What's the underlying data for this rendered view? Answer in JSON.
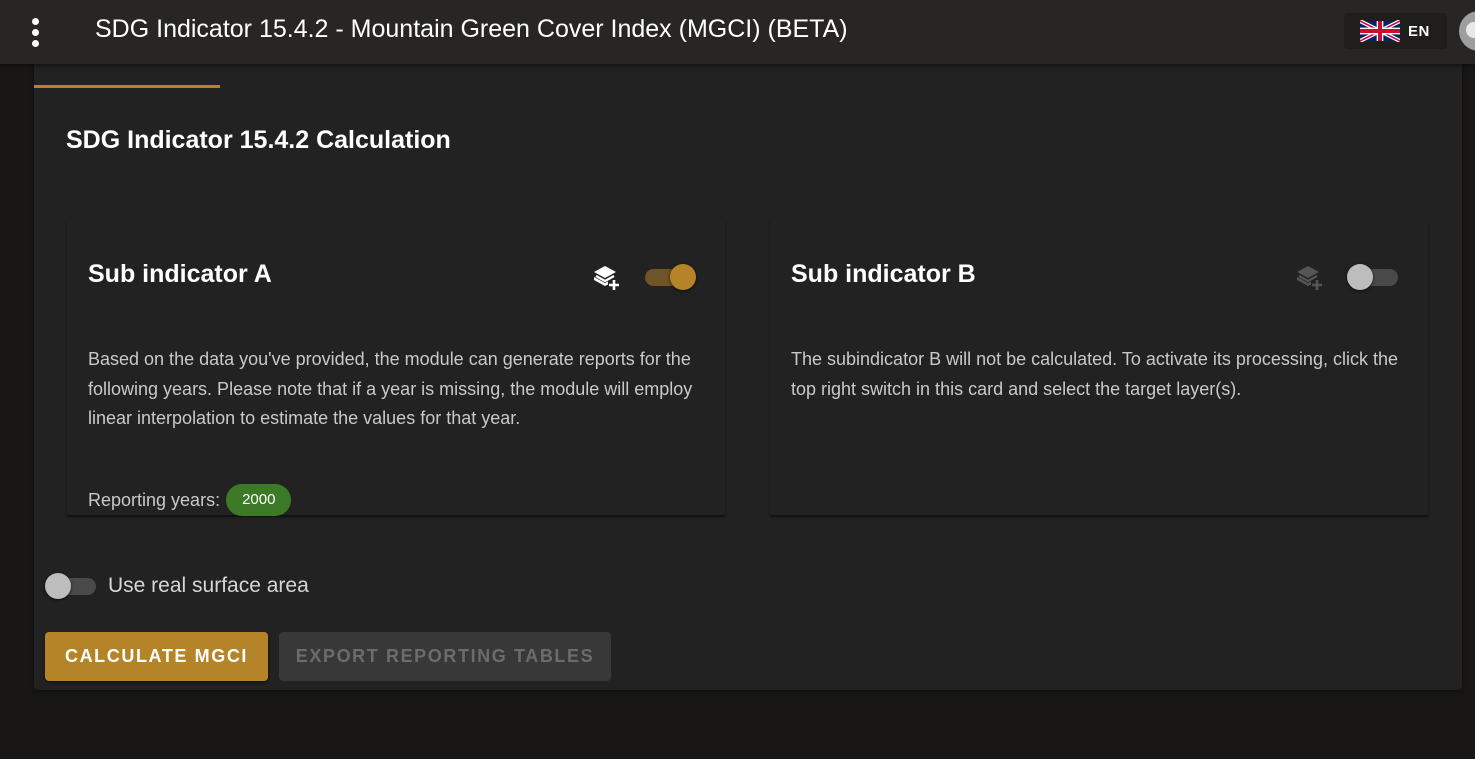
{
  "appbar": {
    "title": "SDG Indicator 15.4.2 - Mountain Green Cover Index (MGCI) (BETA)",
    "menu_icon": "more-vert-icon",
    "language": {
      "code": "EN",
      "flag_icon": "uk-flag-icon"
    },
    "avatar_icon": "avatar-icon"
  },
  "main": {
    "section_title": "SDG Indicator 15.4.2 Calculation",
    "subindicators": [
      {
        "title": "Sub indicator A",
        "enabled": true,
        "layer_icon": "layer-plus-icon",
        "description": "Based on the data you've provided, the module can generate reports for the following years. Please note that if a year is missing, the module will employ linear interpolation to estimate the values for that year.",
        "reporting_label": "Reporting years:",
        "reporting_years": [
          "2000"
        ]
      },
      {
        "title": "Sub indicator B",
        "enabled": false,
        "layer_icon": "layer-plus-icon",
        "description": "The subindicator B will not be calculated. To activate its processing, click the top right switch in this card and select the target layer(s)."
      }
    ],
    "real_surface": {
      "label": "Use real surface area",
      "enabled": false
    },
    "buttons": {
      "calculate": "CALCULATE MGCI",
      "export": "EXPORT REPORTING TABLES"
    }
  },
  "colors": {
    "accent": "#b68428",
    "chip_green": "#3d7a28",
    "appbar_bg": "#272624",
    "card_bg": "#222222",
    "page_bg": "#181716"
  }
}
